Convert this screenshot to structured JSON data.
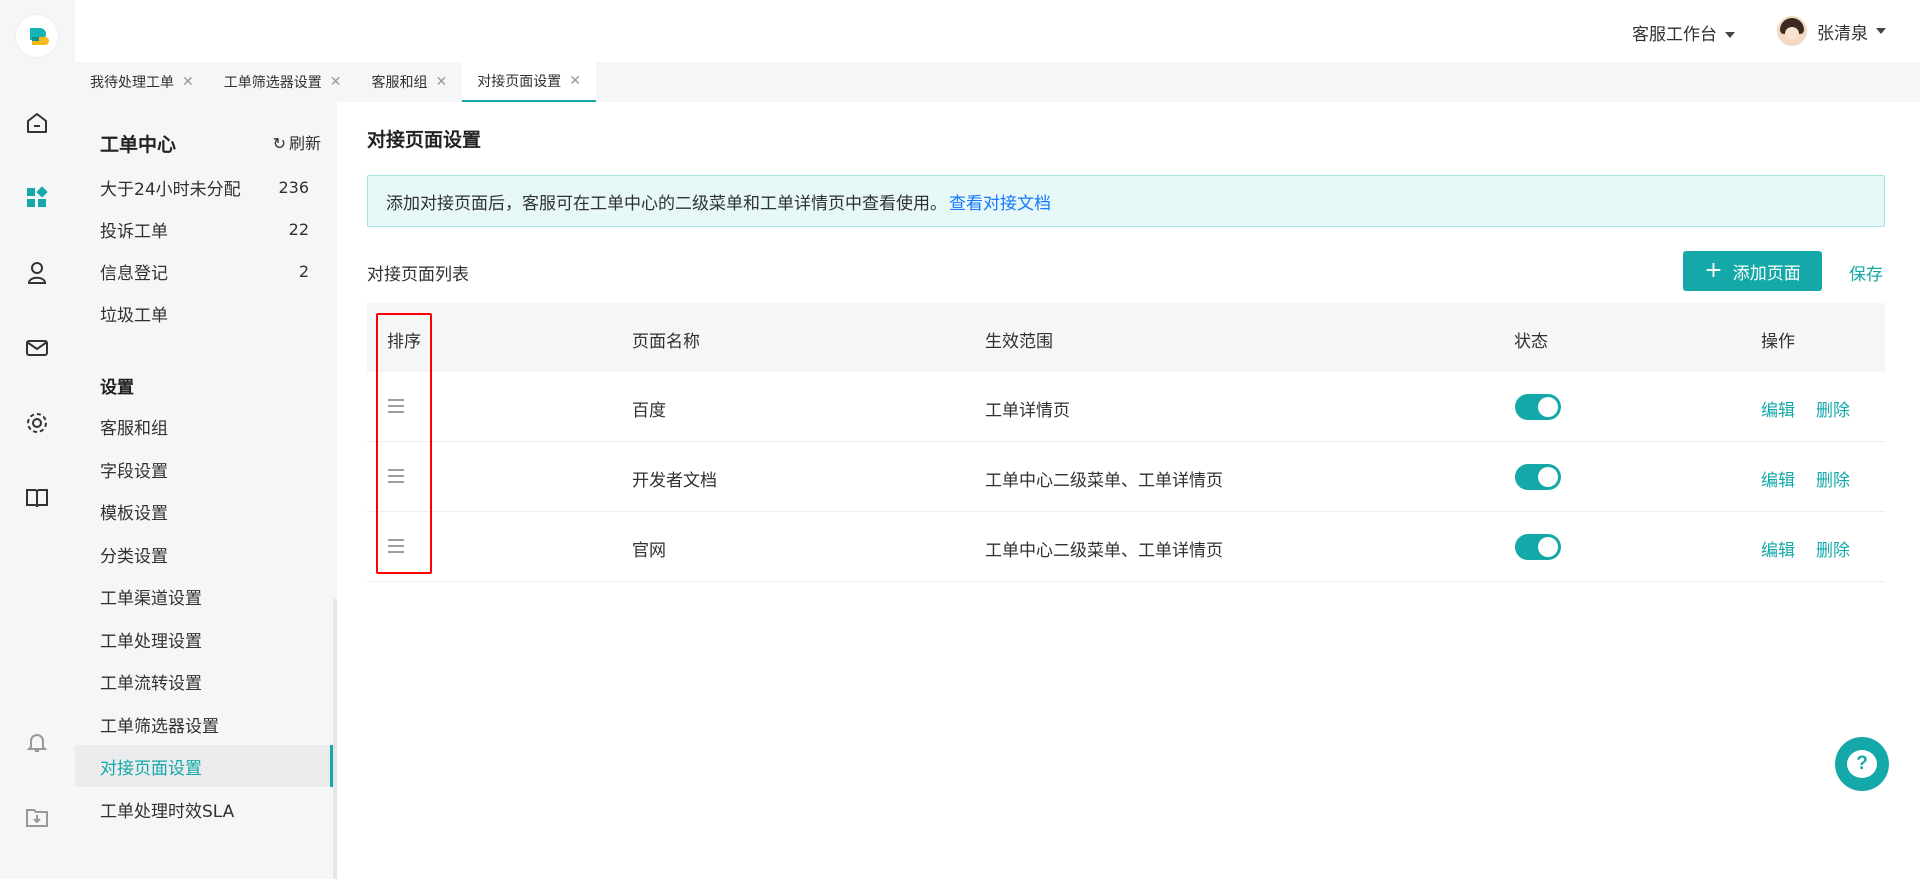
{
  "header": {
    "workbench_label": "客服工作台",
    "user_name": "张清泉"
  },
  "tabs": [
    {
      "label": "我待处理工单"
    },
    {
      "label": "工单筛选器设置"
    },
    {
      "label": "客服和组"
    },
    {
      "label": "对接页面设置"
    }
  ],
  "subnav": {
    "title": "工单中心",
    "refresh_label": "刷新",
    "views": [
      {
        "label": "大于24小时未分配",
        "count": "236"
      },
      {
        "label": "投诉工单",
        "count": "22"
      },
      {
        "label": "信息登记",
        "count": "2"
      },
      {
        "label": "垃圾工单",
        "count": ""
      }
    ],
    "settings_title": "设置",
    "settings": [
      {
        "label": "客服和组"
      },
      {
        "label": "字段设置"
      },
      {
        "label": "模板设置"
      },
      {
        "label": "分类设置"
      },
      {
        "label": "工单渠道设置"
      },
      {
        "label": "工单处理设置"
      },
      {
        "label": "工单流转设置"
      },
      {
        "label": "工单筛选器设置"
      },
      {
        "label": "对接页面设置"
      },
      {
        "label": "工单处理时效SLA"
      }
    ]
  },
  "main": {
    "title": "对接页面设置",
    "notice_text": "添加对接页面后，客服可在工单中心的二级菜单和工单详情页中查看使用。",
    "notice_link": "查看对接文档",
    "list_title": "对接页面列表",
    "add_button": "添加页面",
    "save_link": "保存",
    "columns": [
      "排序",
      "页面名称",
      "生效范围",
      "状态",
      "操作"
    ],
    "rows": [
      {
        "name": "百度",
        "scope": "工单详情页",
        "enabled": true
      },
      {
        "name": "开发者文档",
        "scope": "工单中心二级菜单、工单详情页",
        "enabled": true
      },
      {
        "name": "官网",
        "scope": "工单中心二级菜单、工单详情页",
        "enabled": true
      }
    ],
    "edit_label": "编辑",
    "delete_label": "删除"
  },
  "help_icon": "?",
  "colors": {
    "accent": "#14a8a8",
    "link": "#1677ff",
    "highlight": "#ff0000"
  }
}
